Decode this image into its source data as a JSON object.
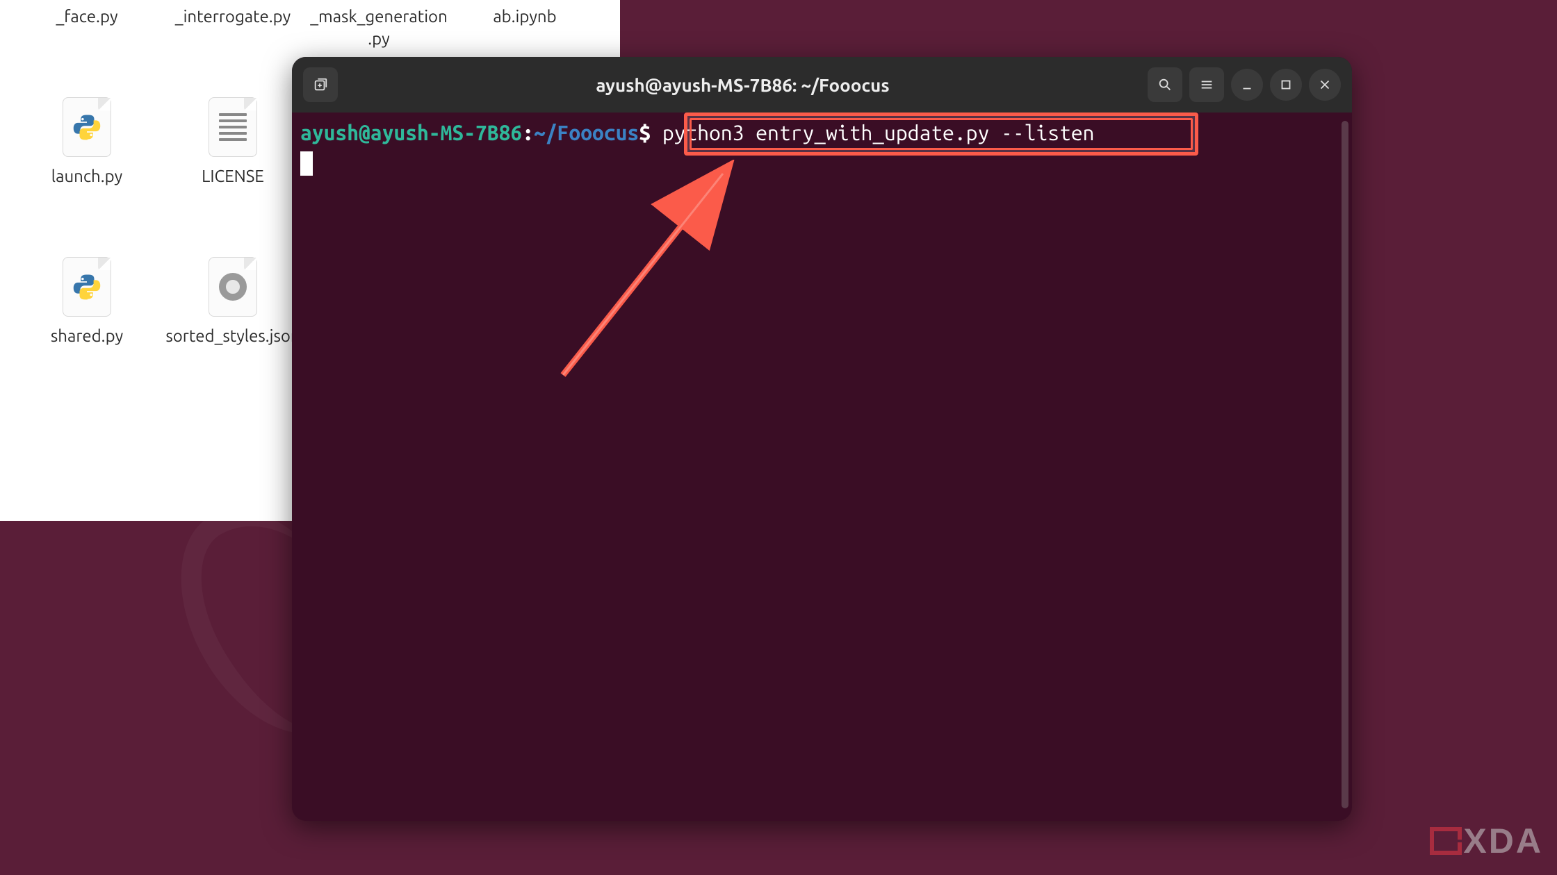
{
  "file_manager": {
    "files_row1": [
      {
        "label": "_face.py"
      },
      {
        "label": "_interrogate.py"
      },
      {
        "label": "_mask_generation.py"
      },
      {
        "label": "ab.ipynb"
      }
    ],
    "files_row2": [
      {
        "label": "launch.py",
        "type": "python"
      },
      {
        "label": "LICENSE",
        "type": "text"
      }
    ],
    "files_row3": [
      {
        "label": "shared.py",
        "type": "python"
      },
      {
        "label": "sorted_styles.json",
        "type": "json"
      }
    ]
  },
  "terminal": {
    "title": "ayush@ayush-MS-7B86: ~/Fooocus",
    "prompt_user": "ayush@ayush-MS-7B86",
    "prompt_colon": ":",
    "prompt_path": "~/Fooocus",
    "prompt_dollar": "$",
    "command": "python3 entry_with_update.py --listen"
  },
  "watermark": {
    "text": "XDA"
  }
}
